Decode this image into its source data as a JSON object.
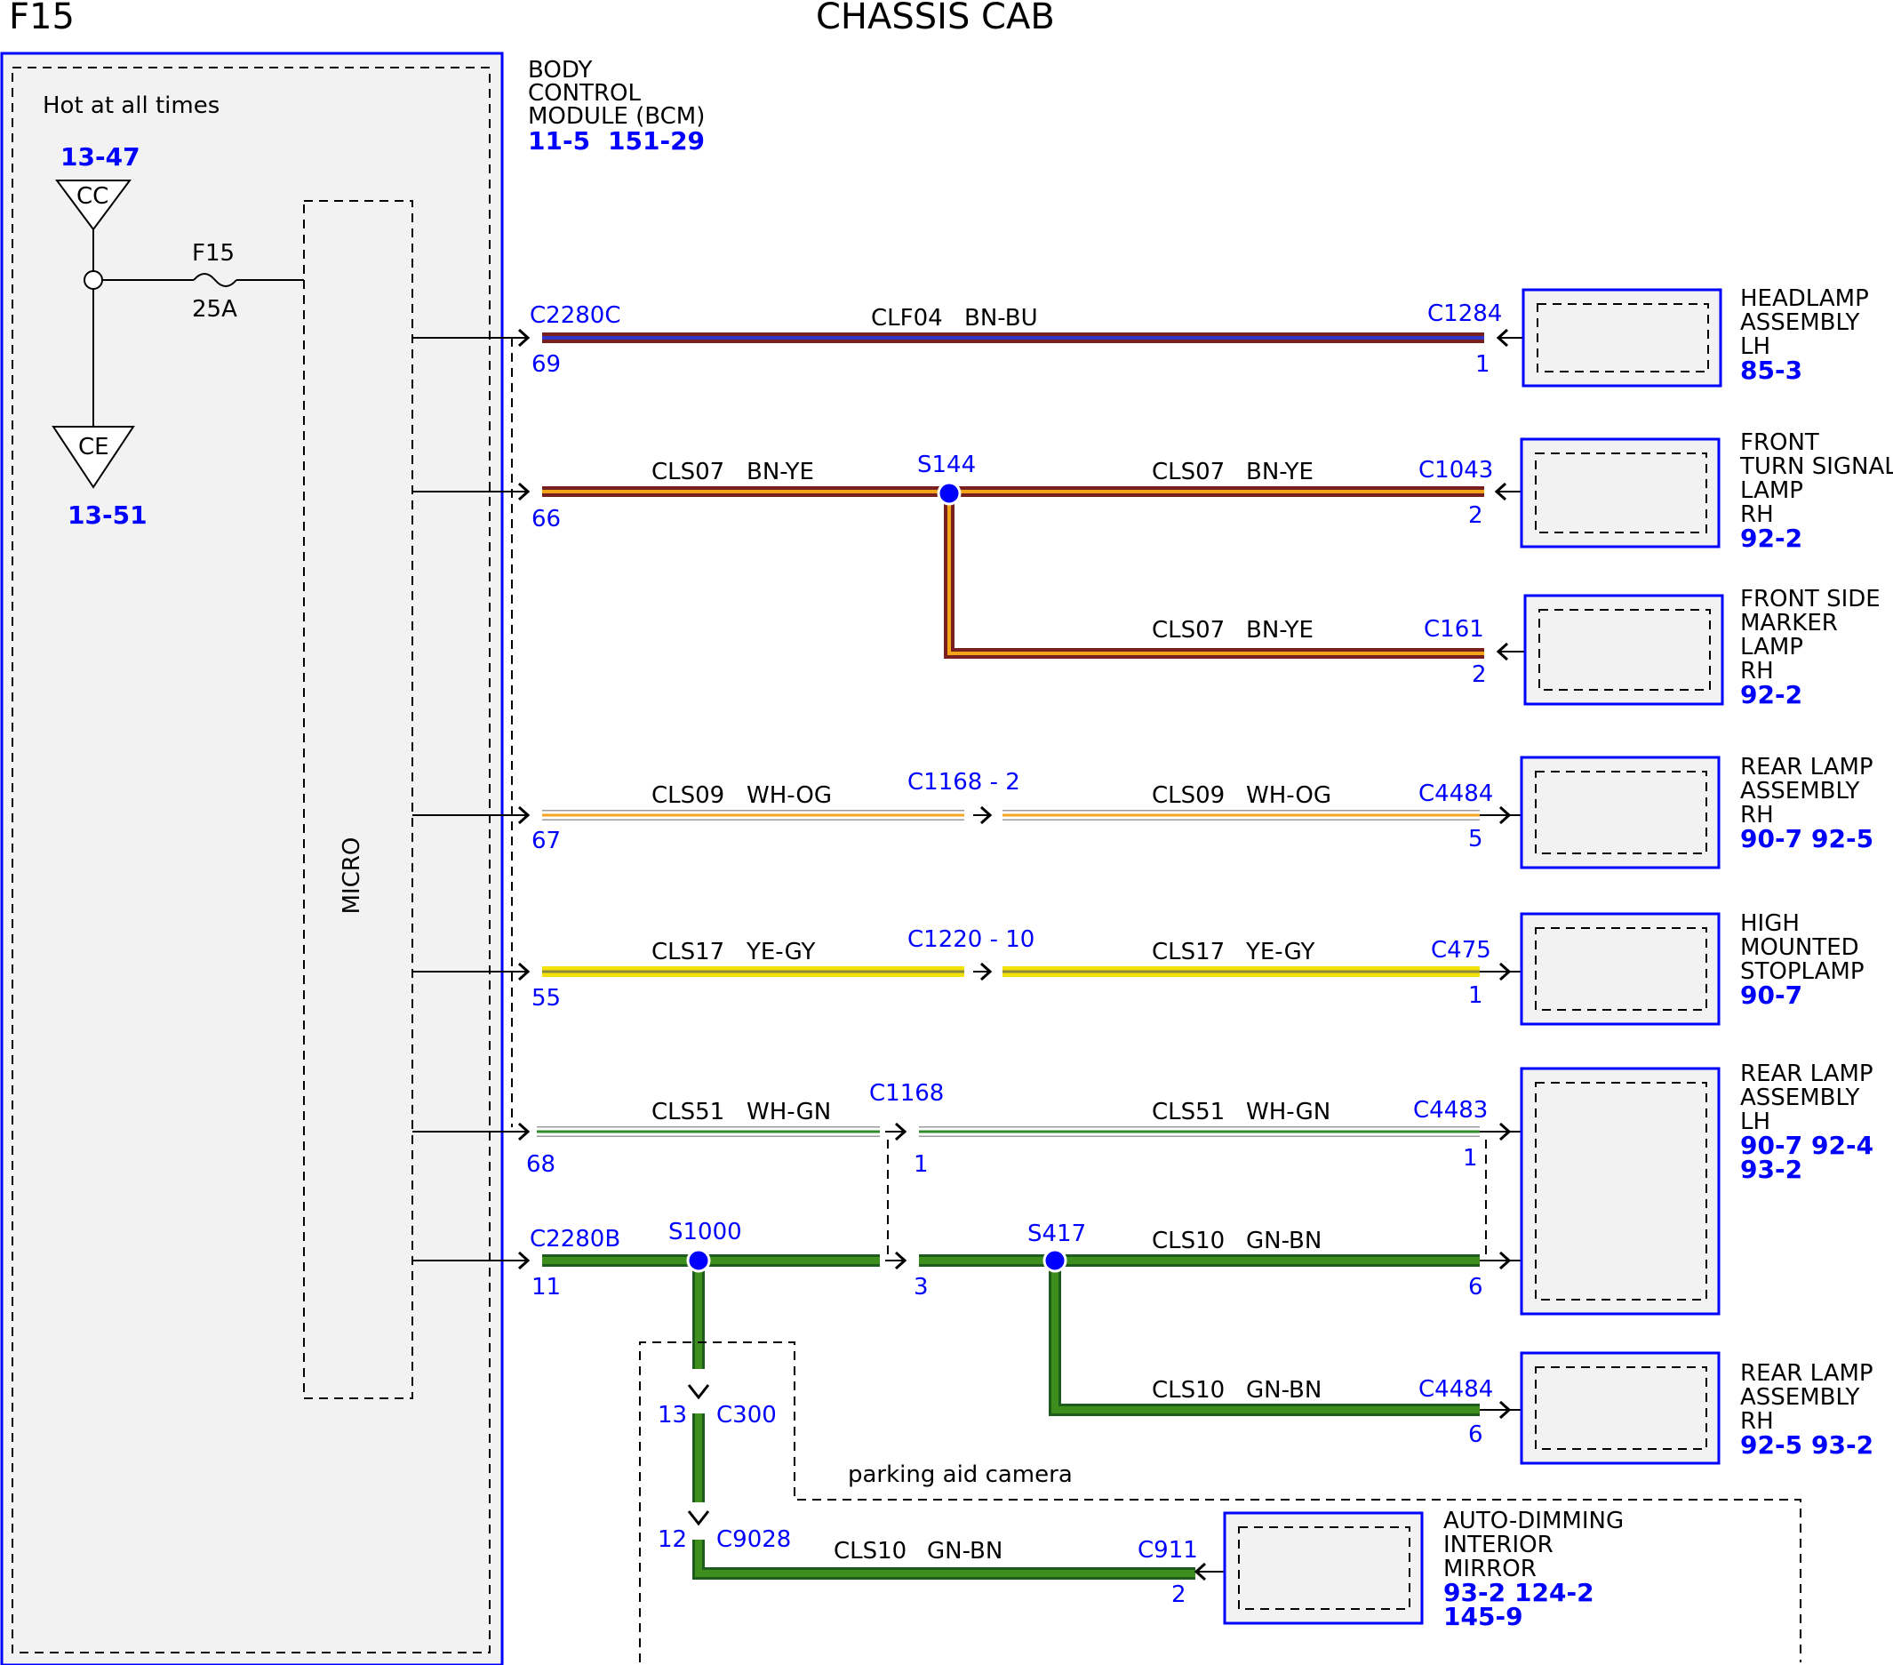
{
  "header": {
    "fuse_title": "F15",
    "page_title": "CHASSIS CAB"
  },
  "colors": {
    "blue": "#0000ff",
    "box_fill": "#f2f2f2",
    "panel_border": "#0000ff"
  },
  "left_panel": {
    "hot_label": "Hot at all times",
    "cc": {
      "ref": "13-47",
      "label": "CC"
    },
    "ce": {
      "ref": "13-51",
      "label": "CE"
    },
    "fuse": {
      "name": "F15",
      "rating": "25A"
    },
    "micro_label": "MICRO"
  },
  "bcm": {
    "line1": "BODY",
    "line2": "CONTROL",
    "line3": "MODULE (BCM)",
    "ref1": "11-5",
    "ref2": "151-29"
  },
  "labels": {
    "c2280c": "C2280C",
    "c2280b": "C2280B",
    "clf04": "CLF04",
    "bn_bu": "BN-BU",
    "cls07": "CLS07",
    "bn_ye": "BN-YE",
    "cls09": "CLS09",
    "wh_og": "WH-OG",
    "cls17": "CLS17",
    "ye_gy": "YE-GY",
    "cls51": "CLS51",
    "wh_gn": "WH-GN",
    "cls10": "CLS10",
    "gn_bn": "GN-BN",
    "s144": "S144",
    "s1000": "S1000",
    "s417": "S417",
    "c1284": "C1284",
    "c1043": "C1043",
    "c161": "C161",
    "c1168_2": "C1168 - 2",
    "c4484": "C4484",
    "c1220_10": "C1220 - 10",
    "c475": "C475",
    "c1168": "C1168",
    "c4483": "C4483",
    "c300": "C300",
    "c9028": "C9028",
    "c911": "C911",
    "parking_aid": "parking aid camera"
  },
  "pins": {
    "p69": "69",
    "p66": "66",
    "p67": "67",
    "p55": "55",
    "p68": "68",
    "p11": "11",
    "p1": "1",
    "p2": "2",
    "p5": "5",
    "p3": "3",
    "p6": "6",
    "p13": "13",
    "p12": "12"
  },
  "components": {
    "headlamp_lh": {
      "l1": "HEADLAMP",
      "l2": "ASSEMBLY",
      "l3": "LH",
      "ref": "85-3"
    },
    "front_turn_rh": {
      "l1": "FRONT",
      "l2": "TURN SIGNAL",
      "l3": "LAMP",
      "l4": "RH",
      "ref": "92-2"
    },
    "front_marker_rh": {
      "l1": "FRONT SIDE",
      "l2": "MARKER",
      "l3": "LAMP",
      "l4": "RH",
      "ref": "92-2"
    },
    "rear_lamp_rh_1": {
      "l1": "REAR LAMP",
      "l2": "ASSEMBLY",
      "l3": "RH",
      "ref1": "90-7",
      "ref2": "92-5"
    },
    "hmsl": {
      "l1": "HIGH",
      "l2": "MOUNTED",
      "l3": "STOPLAMP",
      "ref": "90-7"
    },
    "rear_lamp_lh": {
      "l1": "REAR LAMP",
      "l2": "ASSEMBLY",
      "l3": "LH",
      "ref1": "90-7",
      "ref2": "92-4",
      "ref3": "93-2"
    },
    "rear_lamp_rh_2": {
      "l1": "REAR LAMP",
      "l2": "ASSEMBLY",
      "l3": "RH",
      "ref1": "92-5",
      "ref2": "93-2"
    },
    "mirror": {
      "l1": "AUTO-DIMMING",
      "l2": "INTERIOR",
      "l3": "MIRROR",
      "ref1": "93-2",
      "ref2": "124-2",
      "ref3": "145-9"
    }
  }
}
